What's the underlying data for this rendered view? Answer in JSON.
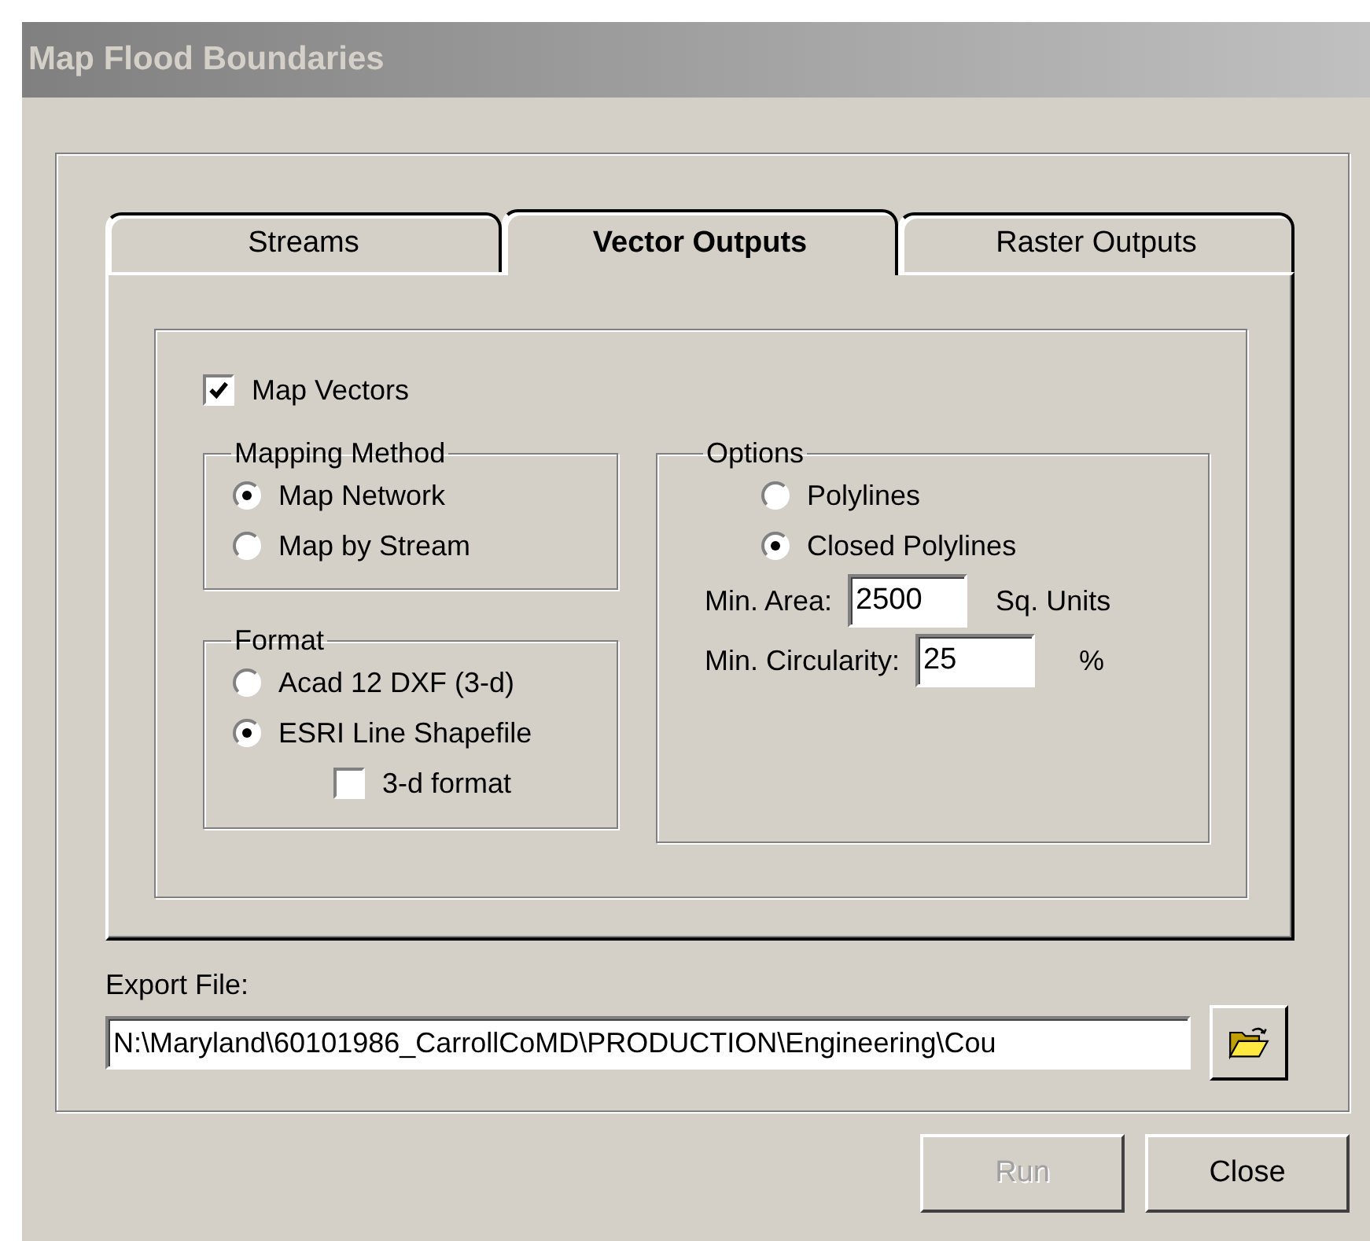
{
  "window": {
    "title": "Map Flood Boundaries"
  },
  "tabs": [
    {
      "label": "Streams",
      "selected": false
    },
    {
      "label": "Vector Outputs",
      "selected": true
    },
    {
      "label": "Raster Outputs",
      "selected": false
    }
  ],
  "map_vectors": {
    "label": "Map Vectors",
    "checked": true
  },
  "mapping_method": {
    "title": "Mapping Method",
    "options": [
      {
        "label": "Map Network",
        "selected": true
      },
      {
        "label": "Map by Stream",
        "selected": false
      }
    ]
  },
  "format": {
    "title": "Format",
    "options": [
      {
        "label": "Acad 12 DXF (3-d)",
        "selected": false
      },
      {
        "label": "ESRI Line Shapefile",
        "selected": true
      }
    ],
    "three_d": {
      "label": "3-d format",
      "checked": false
    }
  },
  "options": {
    "title": "Options",
    "options": [
      {
        "label": "Polylines",
        "selected": false
      },
      {
        "label": "Closed Polylines",
        "selected": true
      }
    ],
    "min_area": {
      "label": "Min. Area:",
      "value": "2500",
      "unit": "Sq. Units"
    },
    "min_circularity": {
      "label": "Min. Circularity:",
      "value": "25",
      "unit": "%"
    }
  },
  "export_file": {
    "label": "Export File:",
    "value": "N:\\Maryland\\60101986_CarrollCoMD\\PRODUCTION\\Engineering\\Cou"
  },
  "buttons": [
    {
      "label": "Run",
      "disabled": true
    },
    {
      "label": "Close",
      "disabled": false
    }
  ]
}
